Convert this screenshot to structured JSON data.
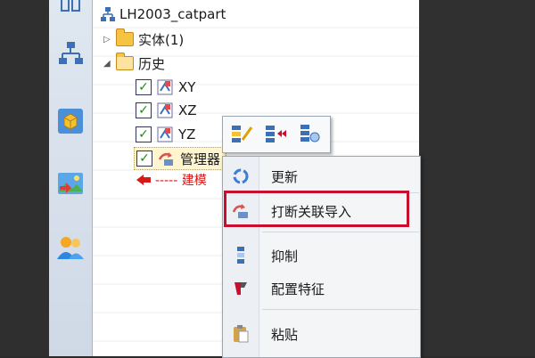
{
  "tree": {
    "root_label": "LH2003_catpart",
    "solid_label": "实体(1)",
    "history_label": "历史",
    "planes": [
      "XY",
      "XZ",
      "YZ"
    ],
    "manager_label": "管理器",
    "build_label": "----- 建模"
  },
  "context_menu": {
    "items": [
      {
        "label": "更新",
        "icon": "refresh-icon"
      },
      {
        "label": "打断关联导入",
        "icon": "break-link-icon"
      },
      {
        "label": "抑制",
        "icon": "suppress-icon"
      },
      {
        "label": "配置特征",
        "icon": "configure-feature-icon"
      },
      {
        "label": "粘贴",
        "icon": "paste-icon"
      }
    ]
  },
  "popup_toolbar": {
    "icons": [
      "edit-feature-icon",
      "rollback-icon",
      "feature-properties-icon"
    ]
  },
  "colors": {
    "highlight": "#c8102e",
    "check": "#1f8a1f",
    "folder": "#f6c343"
  }
}
